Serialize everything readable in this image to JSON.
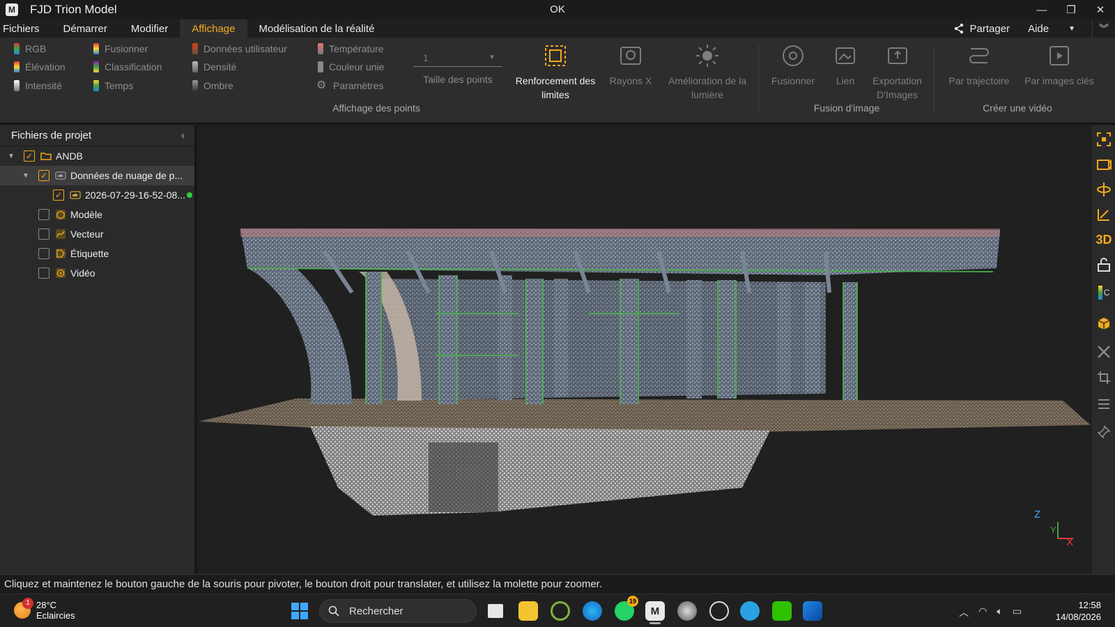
{
  "window": {
    "app_title": "FJD Trion Model",
    "center_title": "OK",
    "minimize": "—",
    "restore": "❐",
    "close": "✕"
  },
  "menu": {
    "items": [
      "Fichiers",
      "Démarrer",
      "Modifier",
      "Affichage",
      "Modélisation de la réalité"
    ],
    "active_index": 3,
    "share_label": "Partager",
    "help_label": "Aide"
  },
  "ribbon": {
    "point_display": {
      "col1": [
        "RGB",
        "Élévation",
        "Intensité"
      ],
      "col2": [
        "Fusionner",
        "Classification",
        "Temps"
      ],
      "col3": [
        "Données utilisateur",
        "Densité",
        "Ombre"
      ],
      "col4": [
        "Température",
        "Couleur unie",
        "Paramètres"
      ],
      "point_size_value": "1",
      "point_size_label": "Taille des points",
      "group_label": "Affichage des points"
    },
    "tools": {
      "boundary": "Renforcement des limites",
      "xray": "Rayons X",
      "light": "Amélioration de la lumière"
    },
    "image_fusion": {
      "merge": "Fusionner",
      "link": "Lien",
      "export": "Exportation D'Images",
      "group_label": "Fusion d'image"
    },
    "video": {
      "trajectory": "Par trajectoire",
      "keyframes": "Par images clés",
      "group_label": "Créer une vidéo"
    }
  },
  "project_panel": {
    "title": "Fichiers de projet",
    "tree": [
      {
        "label": "ANDB",
        "checked": true,
        "icon": "folder-icon"
      },
      {
        "label": "Données de nuage de p...",
        "checked": true,
        "icon": "cloud-icon"
      },
      {
        "label": "2026-07-29-16-52-08...",
        "checked": true,
        "icon": "cloud-icon"
      },
      {
        "label": "Modèle",
        "checked": false,
        "icon": "model-icon"
      },
      {
        "label": "Vecteur",
        "checked": false,
        "icon": "vector-icon"
      },
      {
        "label": "Étiquette",
        "checked": false,
        "icon": "tag-icon"
      },
      {
        "label": "Vidéo",
        "checked": false,
        "icon": "video-icon"
      }
    ]
  },
  "viewport": {
    "axis_z": "Z",
    "axis_y": "Y",
    "axis_x": "X"
  },
  "right_toolbar": {
    "mode_3d": "3D",
    "c_label": "C"
  },
  "status": {
    "hint": "Cliquez et maintenez le bouton gauche de la souris pour pivoter, le bouton droit pour translater, et utilisez la molette pour zoomer."
  },
  "taskbar": {
    "weather_temp": "28°C",
    "weather_desc": "Eclaircies",
    "weather_badge": "1",
    "search_placeholder": "Rechercher",
    "whatsapp_badge": "19",
    "time": "12:58",
    "date": "14/08/2026"
  },
  "colors": {
    "accent": "#f4a91c",
    "ribbon_bg": "#2d2d2d",
    "panel_bg": "#2a2a2a",
    "viewport_bg": "#202020"
  }
}
